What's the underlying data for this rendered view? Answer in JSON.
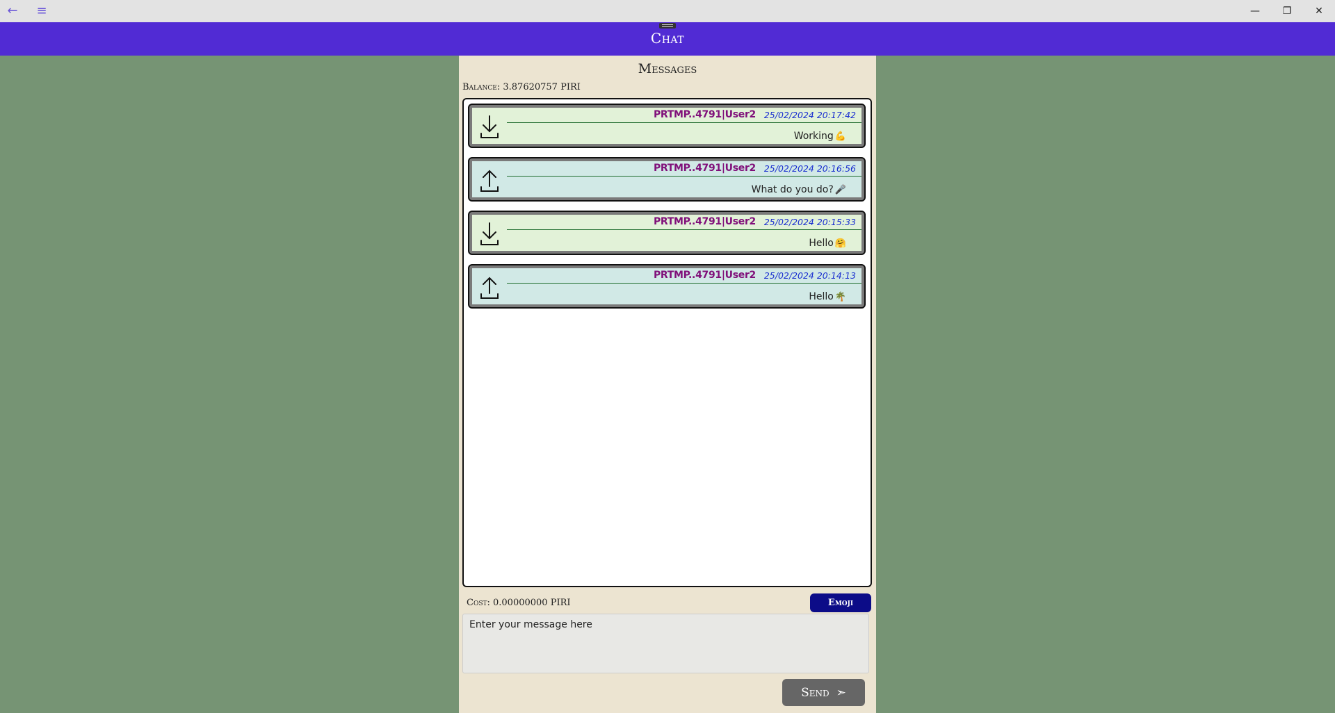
{
  "window": {
    "back_glyph": "←",
    "menu_glyph": "≡",
    "minimize_glyph": "—",
    "restore_glyph": "❐",
    "close_glyph": "✕"
  },
  "header": {
    "title": "Chat"
  },
  "page": {
    "title": "Messages",
    "balance": "Balance: 3.87620757 PIRI"
  },
  "messages": [
    {
      "direction": "received",
      "icon": "download-icon",
      "sender": "PRTMP..4791|User2",
      "timestamp": "25/02/2024 20:17:42",
      "text": "Working",
      "emoji": "💪"
    },
    {
      "direction": "sent",
      "icon": "upload-icon",
      "sender": "PRTMP..4791|User2",
      "timestamp": "25/02/2024 20:16:56",
      "text": "What do you do?",
      "emoji": "🎤"
    },
    {
      "direction": "received",
      "icon": "download-icon",
      "sender": "PRTMP..4791|User2",
      "timestamp": "25/02/2024 20:15:33",
      "text": "Hello",
      "emoji": "🤗"
    },
    {
      "direction": "sent",
      "icon": "upload-icon",
      "sender": "PRTMP..4791|User2",
      "timestamp": "25/02/2024 20:14:13",
      "text": "Hello",
      "emoji": "🌴"
    }
  ],
  "composer": {
    "cost": "Cost: 0.00000000 PIRI",
    "emoji_label": "Emoji",
    "placeholder": "Enter your message here",
    "send_label": "Send",
    "send_glyph": "➣"
  },
  "colors": {
    "header": "#512bd4",
    "background": "#769474",
    "panel": "#ece4d1",
    "received_bubble": "#e2f2d8",
    "sent_bubble": "#d1e9e6",
    "sender_text": "#80107a",
    "timestamp_text": "#1a2fd0"
  }
}
